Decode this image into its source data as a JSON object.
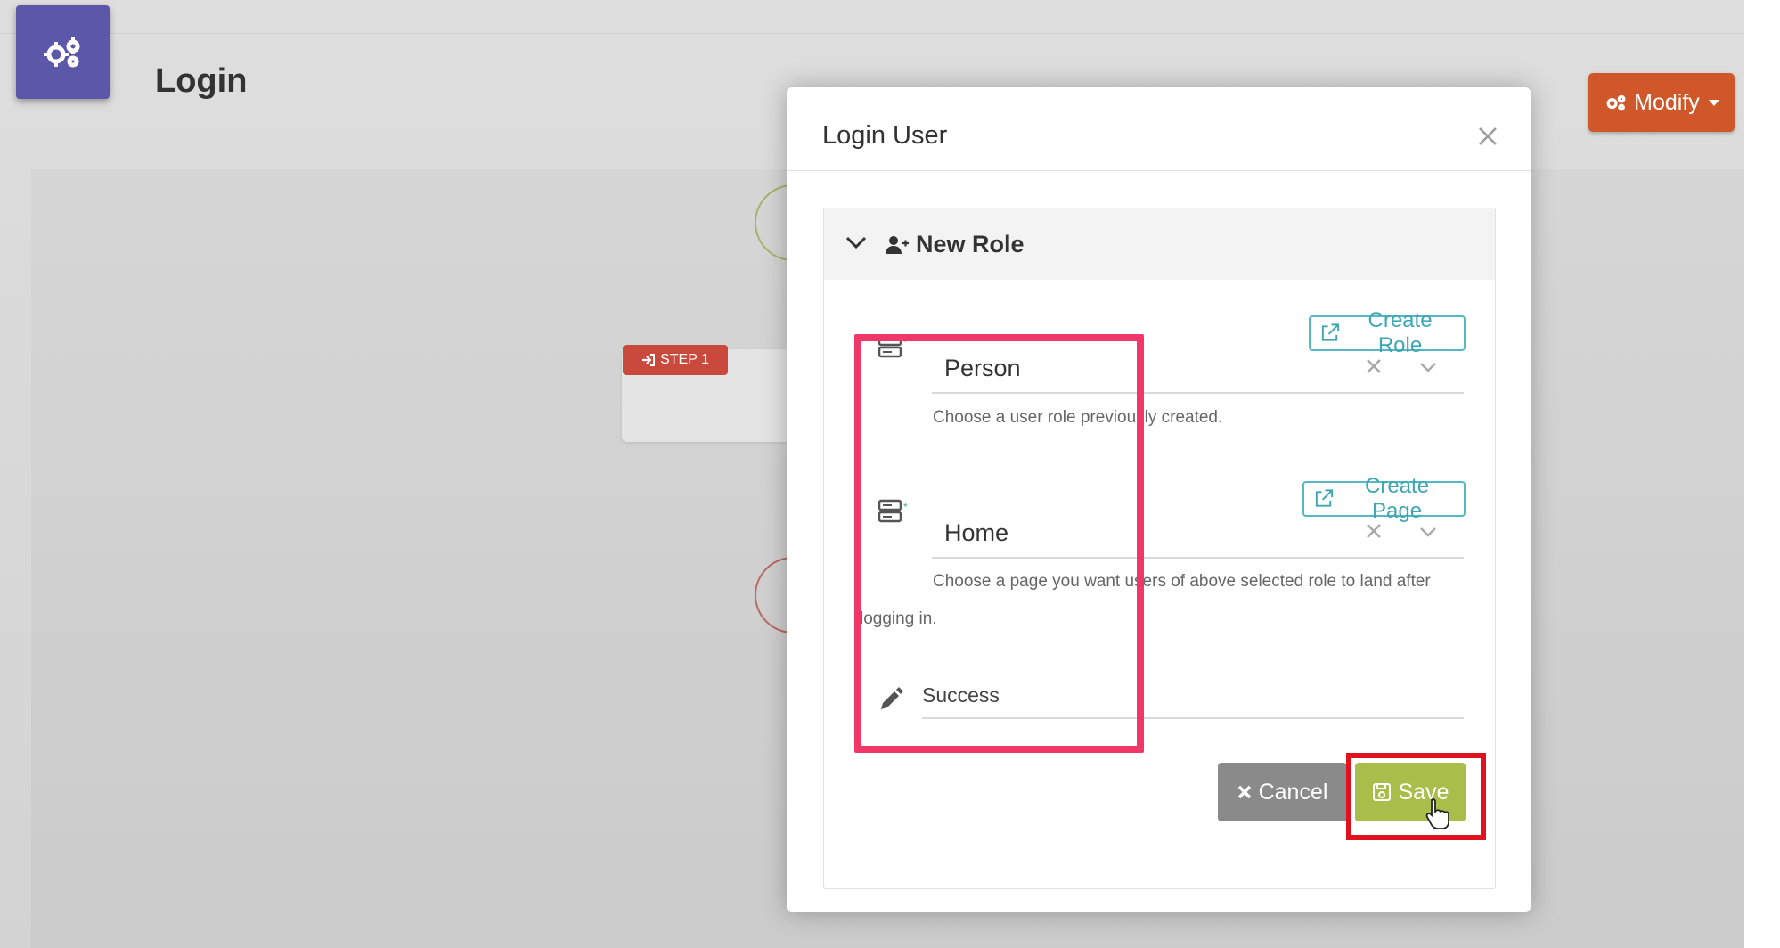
{
  "page": {
    "title": "Login"
  },
  "toolbar": {
    "modify_label": "Modify"
  },
  "workflow": {
    "step_label": "STEP 1"
  },
  "modal": {
    "title": "Login User",
    "section_title": "New Role",
    "create_role_label": "Create Role",
    "create_page_label": "Create Page",
    "role_value": "Person",
    "role_help": "Choose a user role previously created.",
    "page_value": "Home",
    "page_help": "Choose a page you want users of above selected role to land after logging in.",
    "message_value": "Success",
    "cancel_label": "Cancel",
    "save_label": "Save"
  },
  "colors": {
    "brand": "#5c57a8",
    "modify": "#d0572a",
    "step": "#c9493d",
    "save": "#a8bd4a",
    "cancel": "#8a8a8a",
    "outline": "#55b9c3",
    "highlight_pink": "#f03768",
    "highlight_red": "#e0121f"
  },
  "icons": {
    "app": "gears-icon",
    "modify": "gears-icon",
    "step": "sign-in-icon",
    "section": "user-plus-icon",
    "external": "external-link-icon",
    "field": "server-icon",
    "message": "pencil-icon",
    "cancel": "times-icon",
    "save": "floppy-disk-icon"
  }
}
